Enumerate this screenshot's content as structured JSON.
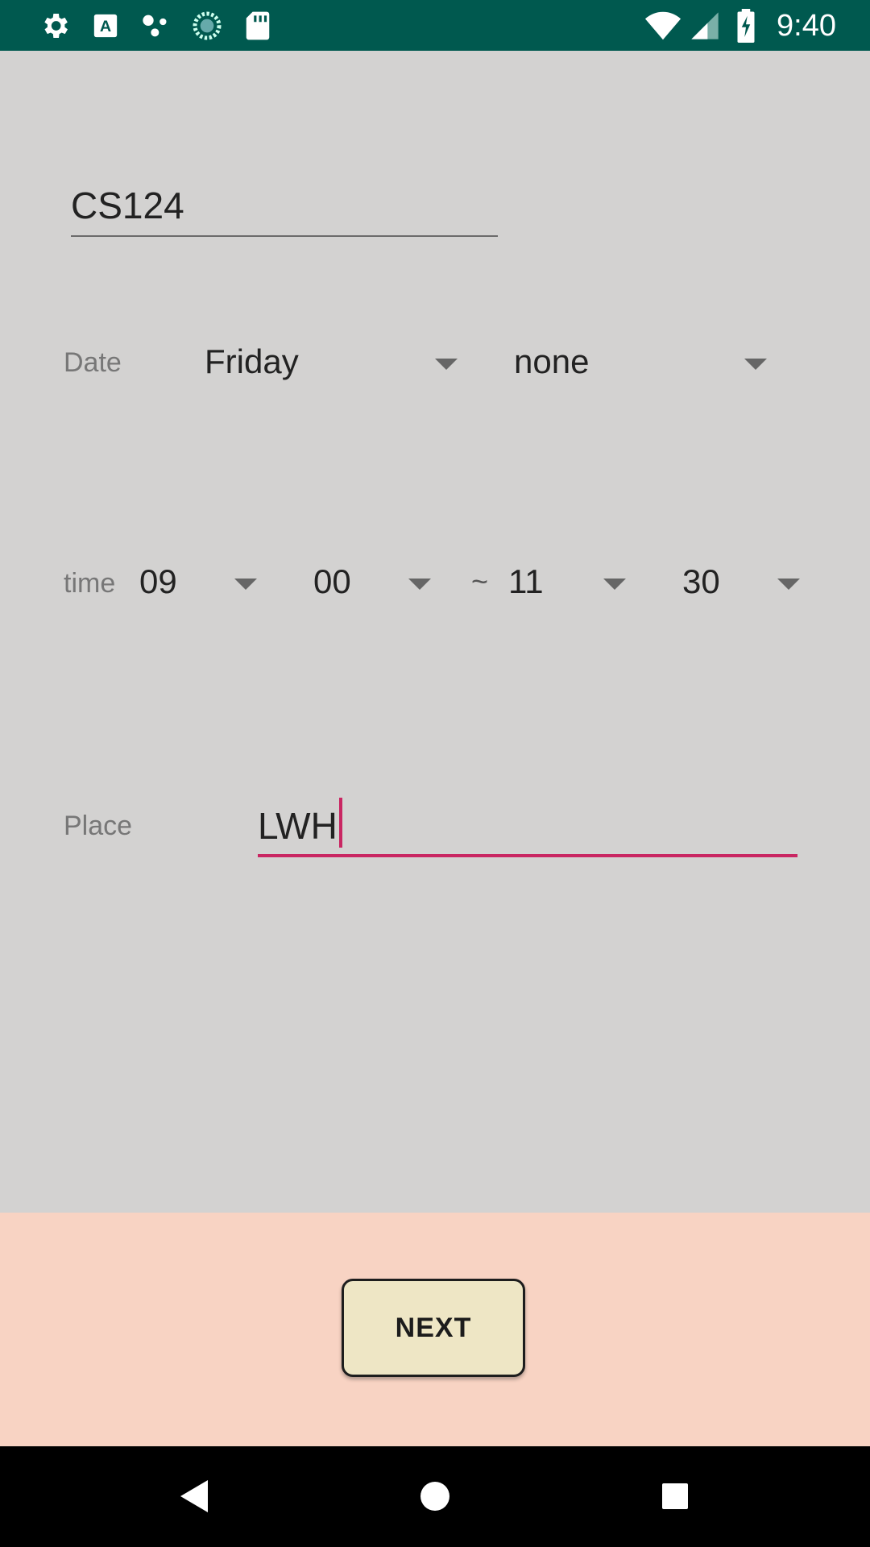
{
  "status_bar": {
    "time": "9:40",
    "icons_left": [
      "gear-icon",
      "text-a-icon",
      "dots-icon",
      "sync-icon",
      "sd-card-icon"
    ],
    "icons_right": [
      "wifi-icon",
      "signal-icon",
      "battery-icon"
    ]
  },
  "form": {
    "course": "CS124",
    "date_label": "Date",
    "date_day": "Friday",
    "date_extra": "none",
    "time_label": "time",
    "start_hour": "09",
    "start_minute": "00",
    "separator": "~",
    "end_hour": "11",
    "end_minute": "30",
    "place_label": "Place",
    "place_value": "LWH"
  },
  "actions": {
    "next_label": "NEXT"
  },
  "colors": {
    "status_bar": "#00594f",
    "background": "#d3d2d1",
    "bottom_area": "#f8d3c3",
    "accent": "#c92662",
    "button": "#eee6c5"
  }
}
